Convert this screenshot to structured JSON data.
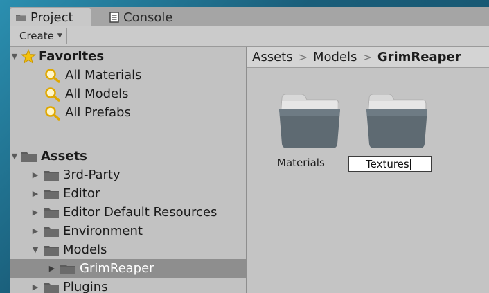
{
  "tabs": {
    "project": "Project",
    "console": "Console"
  },
  "toolbar": {
    "create_label": "Create"
  },
  "tree": {
    "favorites_label": "Favorites",
    "favorites": [
      "All Materials",
      "All Models",
      "All Prefabs"
    ],
    "assets_label": "Assets",
    "folders": [
      "3rd-Party",
      "Editor",
      "Editor Default Resources",
      "Environment",
      "Models",
      "GrimReaper",
      "Plugins"
    ],
    "selected": "GrimReaper"
  },
  "breadcrumb": {
    "items": [
      "Assets",
      "Models",
      "GrimReaper"
    ]
  },
  "grid": {
    "items": [
      {
        "label": "Materials",
        "icon": "folder-icon"
      },
      {
        "label": "Textures",
        "icon": "folder-icon",
        "renaming": true
      }
    ]
  },
  "colors": {
    "panel": "#c2c2c2",
    "selection": "#8e8e8e",
    "desktop": "#1f6d8c"
  }
}
